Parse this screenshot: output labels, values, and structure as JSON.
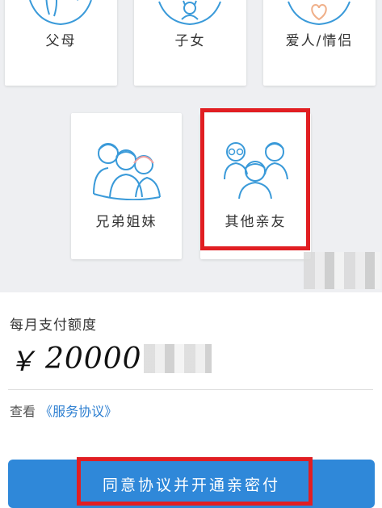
{
  "relations": [
    {
      "label": "父母",
      "icon": "parents-icon"
    },
    {
      "label": "子女",
      "icon": "children-icon"
    },
    {
      "label": "爱人/情侣",
      "icon": "lover-icon"
    },
    {
      "label": "兄弟姐妹",
      "icon": "siblings-icon"
    },
    {
      "label": "其他亲友",
      "icon": "other-relatives-icon"
    }
  ],
  "form": {
    "limit_label": "每月支付额度",
    "currency": "￥",
    "amount": "20000"
  },
  "agreement": {
    "prefix": "查看",
    "link": "《服务协议》"
  },
  "submit_label": "同意协议并开通亲密付",
  "colors": {
    "accent": "#2f88d9",
    "highlight": "#e11e22",
    "icon_stroke": "#3a9ad9"
  }
}
